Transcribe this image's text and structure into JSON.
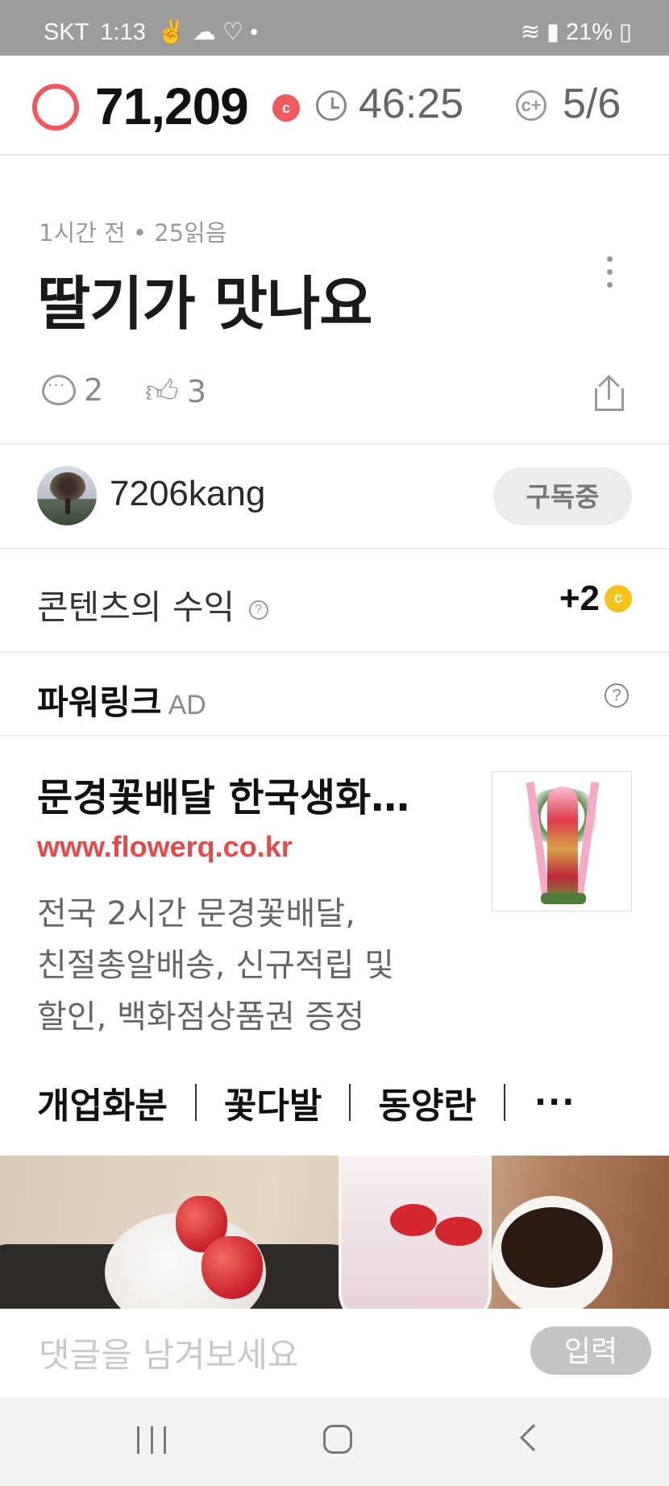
{
  "status_bar": {
    "carrier": "SKT",
    "time": "1:13",
    "battery": "21%"
  },
  "points_bar": {
    "points": "71,209",
    "coin_symbol": "c",
    "timer": "46:25",
    "progress": "5/6",
    "accent_color": "#f05a5f"
  },
  "post": {
    "meta": "1시간 전 • 25읽음",
    "title": "딸기가 맛나요",
    "comments": "2",
    "likes": "3"
  },
  "author": {
    "name": "7206kang",
    "subscribe_label": "구독중"
  },
  "revenue": {
    "label": "콘텐츠의 수익",
    "help": "?",
    "value": "+2",
    "coin_symbol": "c"
  },
  "ad": {
    "header": "파워링크",
    "tag": "AD",
    "help": "?",
    "title": "문경꽃배달 한국생화…",
    "url": "www.flowerq.co.kr",
    "desc_lines": [
      "전국 2시간 문경꽃배달,",
      "친절총알배송, 신규적립 및",
      "할인, 백화점상품권 증정"
    ],
    "links": [
      "개업화분",
      "꽃다발",
      "동양란"
    ],
    "more": "···",
    "url_color": "#e44a4a"
  },
  "comment_bar": {
    "placeholder": "댓글을 남겨보세요",
    "submit_label": "입력"
  }
}
